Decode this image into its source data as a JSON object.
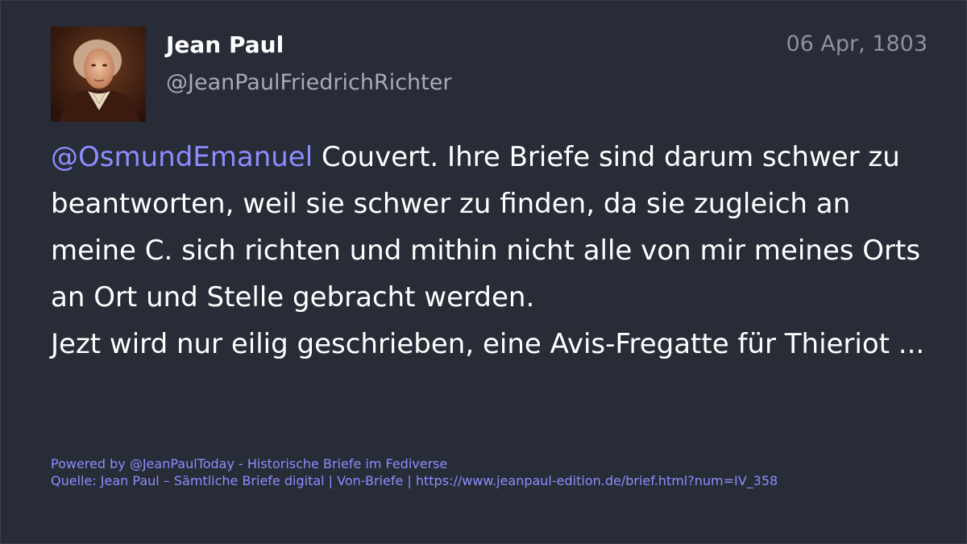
{
  "post": {
    "author": {
      "display_name": "Jean Paul",
      "handle": "@JeanPaulFriedrichRichter",
      "avatar_icon": "portrait-avatar"
    },
    "date": "06 Apr, 1803",
    "mention": "@OsmundEmanuel",
    "text_line_1": " Couvert. Ihre Briefe sind darum schwer zu beantworten, weil sie schwer zu finden, da sie zugleich an meine C. sich richten und mithin nicht alle von mir meines Orts an Ort und Stelle gebracht werden.",
    "text_line_2": "Jezt wird nur eilig geschrieben, eine Avis-Fregatte für Thieriot ..."
  },
  "footer": {
    "powered_by": "Powered by @JeanPaulToday - Historische Briefe im Fediverse",
    "source": "Quelle: Jean Paul – Sämtliche Briefe digital | Von-Briefe | https://www.jeanpaul-edition.de/brief.html?num=IV_358"
  },
  "colors": {
    "background": "#282c37",
    "text": "#ffffff",
    "handle": "#a7abb7",
    "date": "#8e929d",
    "link": "#8c8dff"
  }
}
